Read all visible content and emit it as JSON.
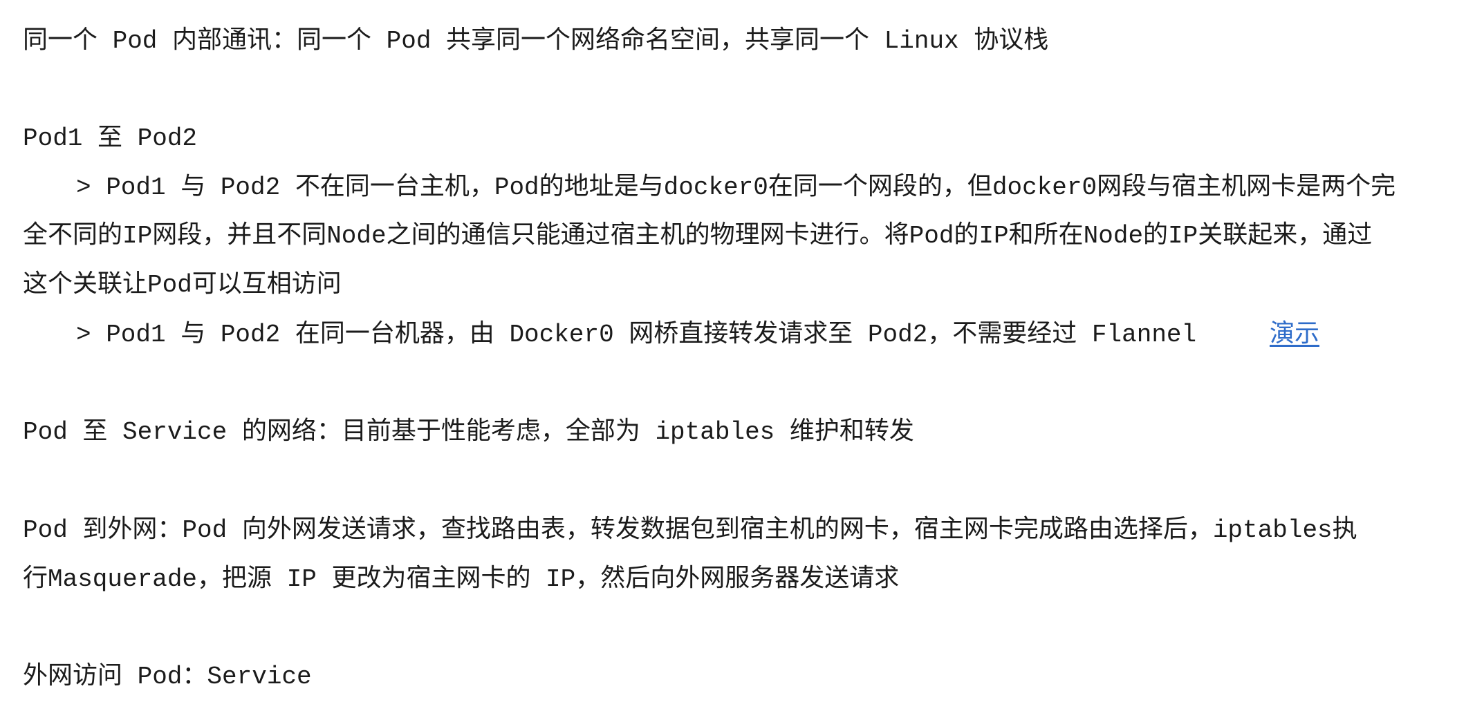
{
  "page": {
    "background": "#ffffff",
    "text_color": "#1b1b1b",
    "link_color": "#2e6cc9"
  },
  "intra_pod": {
    "text": "同一个 Pod 内部通讯：同一个 Pod 共享同一个网络命名空间，共享同一个 Linux 协议栈"
  },
  "pod_to_pod": {
    "heading": "Pod1 至 Pod2",
    "different_host": {
      "lines": [
        "> Pod1 与 Pod2 不在同一台主机，Pod的地址是与docker0在同一个网段的，但docker0网段与宿主机网卡是两个完",
        "全不同的IP网段，并且不同Node之间的通信只能通过宿主机的物理网卡进行。将Pod的IP和所在Node的IP关联起来，通过",
        "这个关联让Pod可以互相访问"
      ]
    },
    "same_host": {
      "text": "> Pod1 与 Pod2 在同一台机器，由 Docker0 网桥直接转发请求至 Pod2，不需要经过 Flannel",
      "link_label": "演示"
    }
  },
  "pod_to_service": {
    "text": "Pod 至 Service 的网络：目前基于性能考虑，全部为 iptables 维护和转发"
  },
  "pod_to_internet": {
    "lines": [
      "Pod 到外网：Pod 向外网发送请求，查找路由表，转发数据包到宿主机的网卡，宿主网卡完成路由选择后，iptables执",
      "行Masquerade，把源 IP 更改为宿主网卡的 IP，然后向外网服务器发送请求"
    ]
  },
  "internet_to_pod": {
    "text": "外网访问 Pod：Service"
  }
}
